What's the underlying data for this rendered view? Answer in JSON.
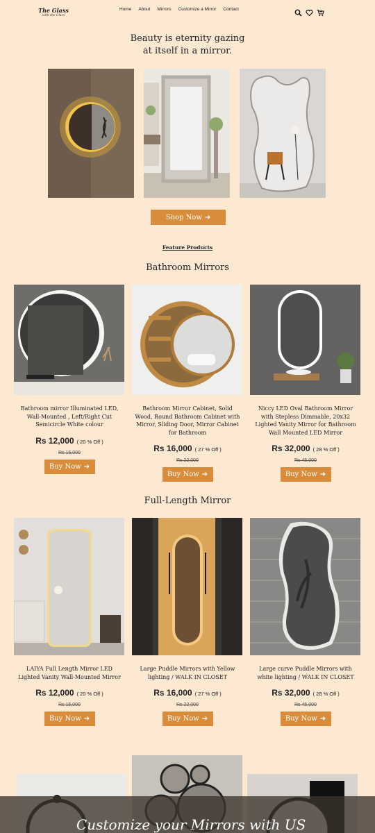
{
  "header": {
    "logo_line1": "The Glass",
    "logo_line2": "with the Class",
    "nav": [
      "Home",
      "About",
      "Mirrors",
      "Customize a Mirror",
      "Contact"
    ],
    "icons": [
      "search-icon",
      "heart-icon",
      "cart-icon"
    ]
  },
  "hero": {
    "title_line1": "Beauty is eternity gazing",
    "title_line2": "at itself in a mirror.",
    "shop_label": "Shop Now",
    "arrow": "➔"
  },
  "feature_link": "Feature Products",
  "sections": [
    {
      "title": "Bathroom Mirrors",
      "products": [
        {
          "name": "Bathroom mirror Illuminated LED, Wall-Mounted , Left/Right Cut Semicircle White colour",
          "price": "Rs 12,000",
          "discount": "( 20 % Off )",
          "old_price": "Rs 15,000",
          "button": "Buy Now"
        },
        {
          "name": "Bathroom Mirror Cabinet, Solid Wood, Round Bathroom Cabinet with Mirror, Sliding Door, Mirror Cabinet for Bathroom",
          "price": "Rs 16,000",
          "discount": "( 27 % Off )",
          "old_price": "Rs 22,000",
          "button": "Buy Now"
        },
        {
          "name": "Niccy LED Oval Bathroom Mirror with Stepless Dimmable, 20x32 Lighted Vanity Mirror for Bathroom Wall Mounted LED Mirror",
          "price": "Rs 32,000",
          "discount": "( 28 % Off )",
          "old_price": "Rs 45,000",
          "button": "Buy Now"
        }
      ]
    },
    {
      "title": "Full-Length Mirror",
      "products": [
        {
          "name": "LAIYA Full Length Mirror LED Lighted Vanity Wall-Mounted Mirror",
          "price": "Rs 12,000",
          "discount": "( 20 % Off )",
          "old_price": "Rs 15,000",
          "button": "Buy Now"
        },
        {
          "name": "Large Puddle Mirrors with Yellow lighting / WALK IN CLOSET",
          "price": "Rs 16,000",
          "discount": "( 27 % Off )",
          "old_price": "Rs 22,000",
          "button": "Buy Now"
        },
        {
          "name": "Large curve Puddle Mirrors with white lighting / WALK IN CLOSET",
          "price": "Rs 32,000",
          "discount": "( 28 % Off )",
          "old_price": "Rs 45,000",
          "button": "Buy Now"
        }
      ]
    }
  ],
  "customize": {
    "text": "Customize your Mirrors with US"
  },
  "colors": {
    "background": "#fde8d2",
    "accent": "#d98d3a"
  }
}
